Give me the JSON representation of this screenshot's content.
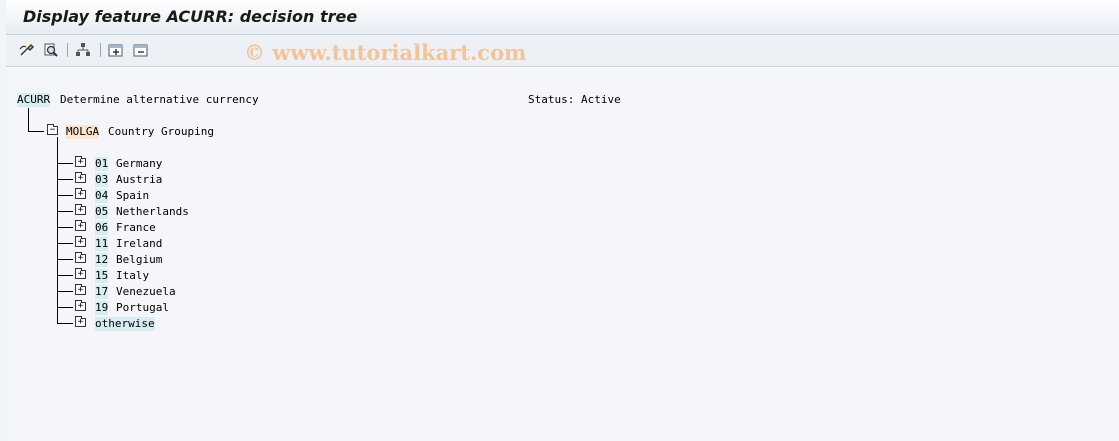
{
  "window": {
    "title": "Display feature ACURR: decision tree"
  },
  "watermark": "© www.tutorialkart.com",
  "toolbar": {
    "buttons": [
      {
        "name": "change-icon"
      },
      {
        "name": "find-icon"
      },
      {
        "name": "structure-icon"
      },
      {
        "name": "expand-subtree-icon"
      },
      {
        "name": "collapse-subtree-icon"
      }
    ]
  },
  "header": {
    "feature": "ACURR",
    "description": "Determine alternative currency",
    "status": "Status: Active"
  },
  "tree": {
    "root": {
      "field": "MOLGA",
      "label": "Country Grouping"
    },
    "nodes": [
      {
        "code": "01",
        "label": "Germany"
      },
      {
        "code": "03",
        "label": "Austria"
      },
      {
        "code": "04",
        "label": "Spain"
      },
      {
        "code": "05",
        "label": "Netherlands"
      },
      {
        "code": "06",
        "label": "France"
      },
      {
        "code": "11",
        "label": "Ireland"
      },
      {
        "code": "12",
        "label": "Belgium"
      },
      {
        "code": "15",
        "label": "Italy"
      },
      {
        "code": "17",
        "label": "Venezuela"
      },
      {
        "code": "19",
        "label": "Portugal"
      },
      {
        "code": "otherwise",
        "label": ""
      }
    ]
  }
}
